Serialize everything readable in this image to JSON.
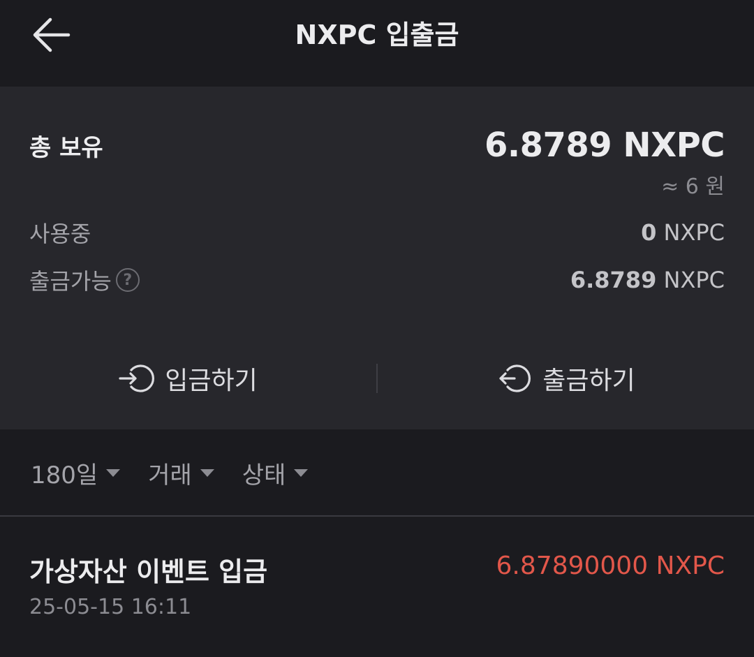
{
  "header": {
    "title": "NXPC 입출금",
    "back_icon": "arrow-left-icon"
  },
  "balance": {
    "total_label": "총 보유",
    "total_value": "6.8789 NXPC",
    "krw_value": "≈ 6 원",
    "in_use_label": "사용중",
    "in_use_amount": "0",
    "in_use_unit": " NXPC",
    "withdrawable_label": "출금가능",
    "withdrawable_amount": "6.8789",
    "withdrawable_unit": " NXPC",
    "help_icon_glyph": "?"
  },
  "actions": {
    "deposit_label": "입금하기",
    "deposit_icon": "deposit-arrow-circle-icon",
    "withdraw_label": "출금하기",
    "withdraw_icon": "withdraw-arrow-circle-icon"
  },
  "filters": [
    {
      "label": "180일"
    },
    {
      "label": "거래"
    },
    {
      "label": "상태"
    }
  ],
  "transactions": [
    {
      "title": "가상자산 이벤트 입금",
      "amount": "6.87890000 NXPC",
      "time": "25-05-15 16:11"
    }
  ],
  "colors": {
    "background": "#1b1b1f",
    "card": "#27272c",
    "deposit_amount": "#e2574a"
  }
}
